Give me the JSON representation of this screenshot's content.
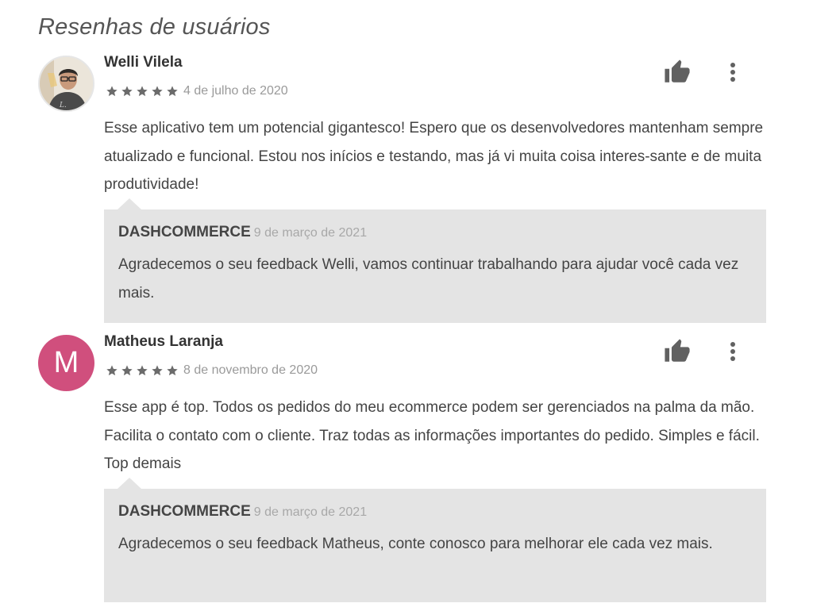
{
  "section": {
    "title": "Resenhas de usuários"
  },
  "colors": {
    "star": "#6b6b6b",
    "avatar_bg": "#d04f7d",
    "reply_bg": "#e4e4e4",
    "icon": "#616161"
  },
  "reviews": [
    {
      "author": "Welli Vilela",
      "avatar": {
        "type": "photo"
      },
      "rating": 5,
      "date": "4 de julho de 2020",
      "text": "Esse aplicativo tem um potencial gigantesco! Espero que os desenvolvedores mantenham sempre atualizado e funcional. Estou nos inícios e testando, mas já vi muita coisa interes-sante e de muita produtividade!",
      "like_icon": "thumb-up-icon",
      "more_icon": "more-vert-icon",
      "reply": {
        "author": "DASHCOMMERCE",
        "date": "9 de março de 2021",
        "text": "Agradecemos o seu feedback Welli, vamos continuar trabalhando para ajudar você cada vez mais."
      }
    },
    {
      "author": "Matheus Laranja",
      "avatar": {
        "type": "letter",
        "letter": "M"
      },
      "rating": 5,
      "date": "8 de novembro de 2020",
      "text": "Esse app é top. Todos os pedidos do meu ecommerce podem ser gerenciados na palma da mão. Facilita o contato com o cliente. Traz todas as informações importantes do pedido. Simples e fácil. Top demais",
      "like_icon": "thumb-up-icon",
      "more_icon": "more-vert-icon",
      "reply": {
        "author": "DASHCOMMERCE",
        "date": "9 de março de 2021",
        "text": "Agradecemos o seu feedback Matheus, conte conosco para melhorar ele cada vez mais."
      }
    }
  ]
}
